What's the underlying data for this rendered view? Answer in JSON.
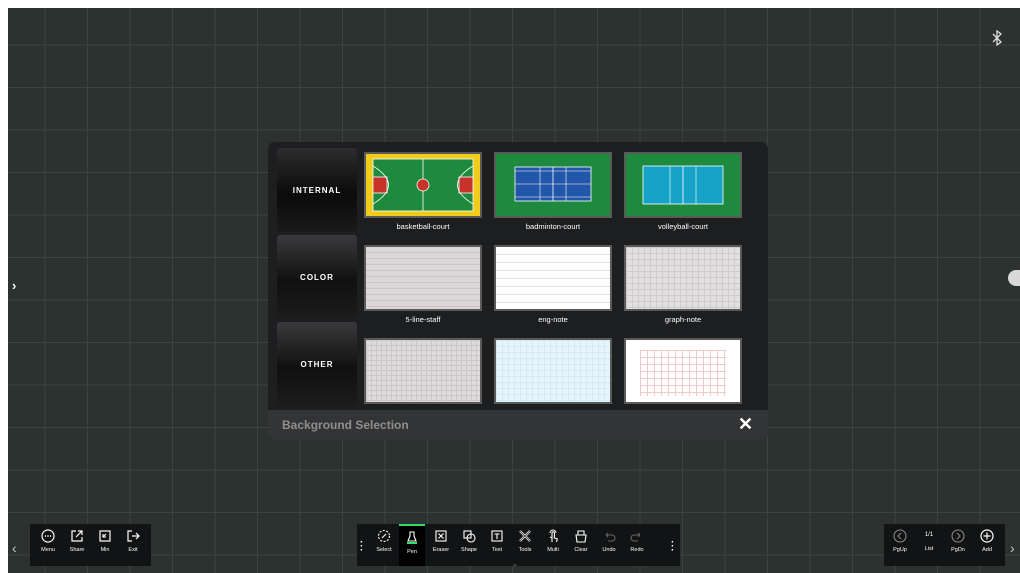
{
  "dialog": {
    "tabs": [
      "INTERNAL",
      "COLOR",
      "OTHER"
    ],
    "tiles": [
      {
        "label": "basketball-court"
      },
      {
        "label": "badminton-court"
      },
      {
        "label": "volleyball-court"
      },
      {
        "label": "5-line-staff"
      },
      {
        "label": "eng-note"
      },
      {
        "label": "graph-note"
      },
      {
        "label": ""
      },
      {
        "label": ""
      },
      {
        "label": ""
      }
    ],
    "title": "Background Selection",
    "close": "✕"
  },
  "left_toolbar": {
    "items": [
      "Menu",
      "Share",
      "Min",
      "Exit"
    ]
  },
  "center_toolbar": {
    "items": [
      "Select",
      "Pen",
      "Eraser",
      "Shape",
      "Text",
      "Tools",
      "Multi",
      "Clear",
      "Undo",
      "Redo"
    ]
  },
  "right_toolbar": {
    "items": [
      "PgUp",
      "List",
      "PgDn",
      "Add"
    ],
    "page": "1/1"
  },
  "colors": {
    "board": "#2b3230",
    "court_green": "#1e8a3e",
    "court_yellow": "#f1cc1c",
    "court_blue": "#2256a8",
    "court_cyan": "#17a2c8",
    "accent_green": "#2ee06a"
  }
}
